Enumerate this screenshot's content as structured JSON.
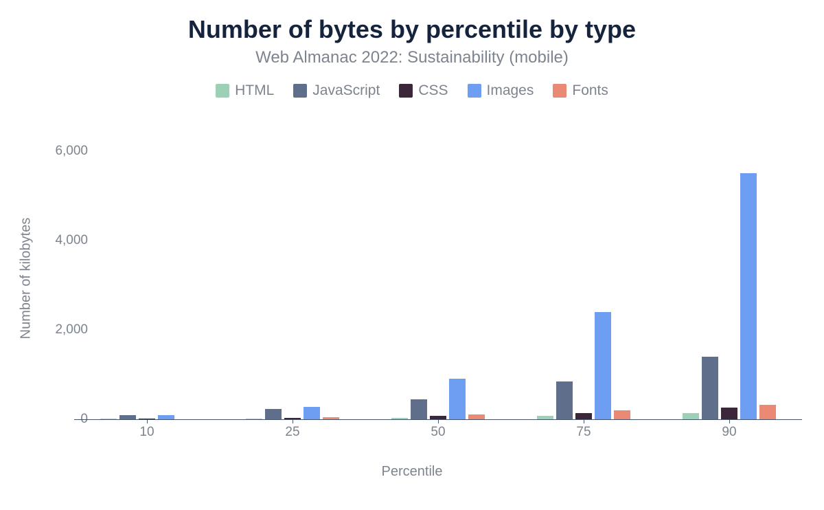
{
  "title": "Number of bytes by percentile by type",
  "subtitle": "Web Almanac 2022: Sustainability (mobile)",
  "xlabel": "Percentile",
  "ylabel": "Number of kilobytes",
  "legend": {
    "items": [
      {
        "label": "HTML"
      },
      {
        "label": "JavaScript"
      },
      {
        "label": "CSS"
      },
      {
        "label": "Images"
      },
      {
        "label": "Fonts"
      }
    ]
  },
  "chart_data": {
    "type": "bar",
    "xlabel": "Percentile",
    "ylabel": "Number of kilobytes",
    "categories": [
      "10",
      "25",
      "50",
      "75",
      "90"
    ],
    "series": [
      {
        "name": "HTML",
        "color": "#9bd1b4",
        "values": [
          10,
          15,
          30,
          70,
          140
        ]
      },
      {
        "name": "JavaScript",
        "color": "#5e6e8b",
        "values": [
          90,
          230,
          450,
          850,
          1400
        ]
      },
      {
        "name": "CSS",
        "color": "#3b263a",
        "values": [
          10,
          30,
          70,
          140,
          260
        ]
      },
      {
        "name": "Images",
        "color": "#6d9ef1",
        "values": [
          90,
          270,
          900,
          2400,
          5500
        ]
      },
      {
        "name": "Fonts",
        "color": "#ea8a74",
        "values": [
          0,
          50,
          110,
          200,
          320
        ]
      }
    ],
    "ylim": [
      0,
      6300
    ],
    "yticks": [
      0,
      2000,
      4000,
      6000
    ],
    "ytick_labels": [
      "0",
      "2,000",
      "4,000",
      "6,000"
    ],
    "legend_position": "top",
    "grid": false
  }
}
